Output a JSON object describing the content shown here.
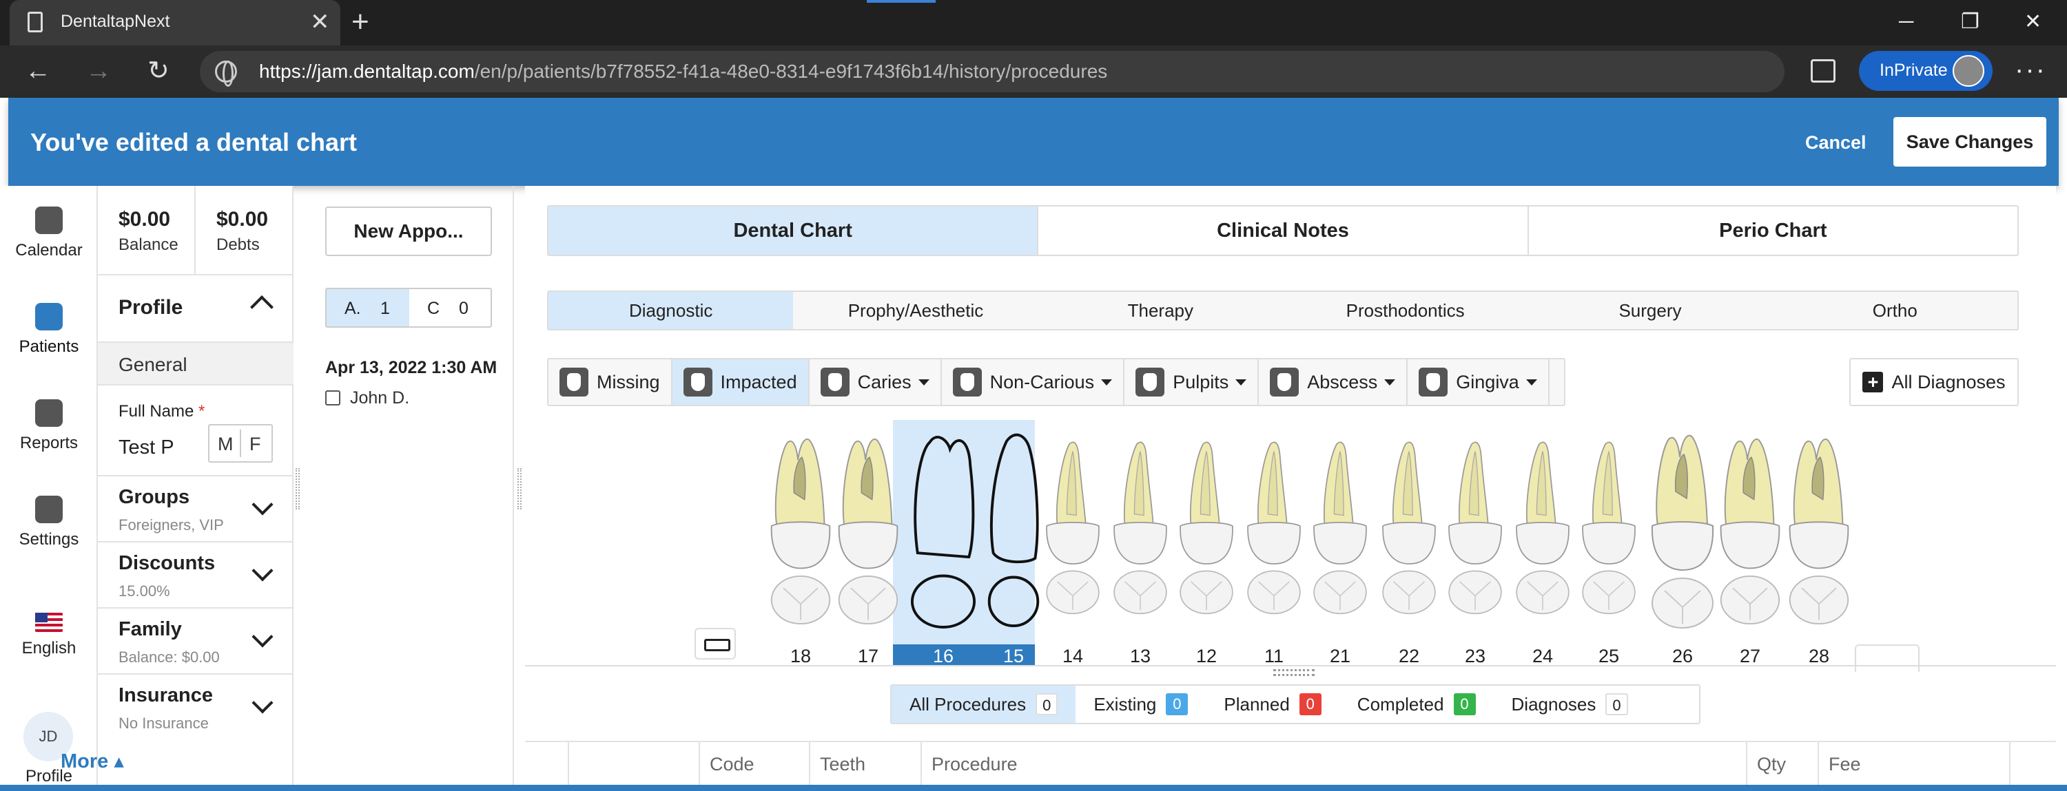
{
  "browser": {
    "tab_title": "DentaltapNext",
    "url_domain": "https://jam.dentaltap.com",
    "url_path": "/en/p/patients/b7f78552-f41a-48e0-8314-e9f1743f6b14/history/procedures",
    "inprivate_label": "InPrivate",
    "accent_color": "#1a63c7"
  },
  "banner": {
    "message": "You've edited a dental chart",
    "cancel_label": "Cancel",
    "save_label": "Save Changes",
    "color": "#2e7bbf"
  },
  "nav": {
    "items": [
      {
        "label": "Calendar",
        "icon": "calendar-icon"
      },
      {
        "label": "Patients",
        "icon": "patients-icon",
        "active": true
      },
      {
        "label": "Reports",
        "icon": "reports-icon"
      },
      {
        "label": "Settings",
        "icon": "gear-icon"
      },
      {
        "label": "English",
        "icon": "us-flag-icon"
      },
      {
        "label": "Profile",
        "icon": "avatar"
      }
    ],
    "avatar_initials": "JD"
  },
  "patient": {
    "balance_value": "$0.00",
    "balance_label": "Balance",
    "debts_value": "$0.00",
    "debts_label": "Debts",
    "profile_heading": "Profile",
    "general_label": "General",
    "fullname_label": "Full Name",
    "fullname_required": "*",
    "fullname_value": "Test P",
    "sex_m": "M",
    "sex_f": "F",
    "sections": [
      {
        "title": "Groups",
        "subtitle": "Foreigners, VIP"
      },
      {
        "title": "Discounts",
        "subtitle": "15.00%"
      },
      {
        "title": "Family",
        "subtitle": "Balance: $0.00"
      },
      {
        "title": "Insurance",
        "subtitle": "No Insurance"
      }
    ],
    "more_label": "More ▴"
  },
  "appointments": {
    "new_label": "New Appo...",
    "seg_a_label": "A.",
    "seg_a_count": "1",
    "seg_c_label": "C",
    "seg_c_count": "0",
    "date": "Apr 13, 2022 1:30 AM",
    "person": "John D."
  },
  "main": {
    "tabs": [
      "Dental Chart",
      "Clinical Notes",
      "Perio Chart"
    ],
    "active_tab": 0,
    "subtabs": [
      "Diagnostic",
      "Prophy/Aesthetic",
      "Therapy",
      "Prosthodontics",
      "Surgery",
      "Ortho"
    ],
    "active_subtab": 0,
    "diagnoses": [
      {
        "label": "Missing",
        "dropdown": false
      },
      {
        "label": "Impacted",
        "dropdown": false,
        "active": true
      },
      {
        "label": "Caries",
        "dropdown": true
      },
      {
        "label": "Non-Carious",
        "dropdown": true
      },
      {
        "label": "Pulpits",
        "dropdown": true
      },
      {
        "label": "Abscess",
        "dropdown": true
      },
      {
        "label": "Gingiva",
        "dropdown": true
      }
    ],
    "all_diagnoses_label": "All Diagnoses",
    "teeth": [
      "18",
      "17",
      "16",
      "15",
      "14",
      "13",
      "12",
      "11",
      "21",
      "22",
      "23",
      "24",
      "25",
      "26",
      "27",
      "28"
    ],
    "selected_teeth": [
      "16",
      "15"
    ],
    "filters": [
      {
        "label": "All Procedures",
        "count": "0",
        "color": "#ffffff",
        "text": "#222222"
      },
      {
        "label": "Existing",
        "count": "0",
        "color": "#4aa8e8",
        "text": "#ffffff"
      },
      {
        "label": "Planned",
        "count": "0",
        "color": "#e8413a",
        "text": "#ffffff"
      },
      {
        "label": "Completed",
        "count": "0",
        "color": "#34b44a",
        "text": "#ffffff"
      },
      {
        "label": "Diagnoses",
        "count": "0",
        "color": "#ffffff",
        "text": "#222222"
      }
    ],
    "columns": [
      "",
      "",
      "Code",
      "Teeth",
      "Procedure",
      "Qty",
      "Fee"
    ]
  }
}
